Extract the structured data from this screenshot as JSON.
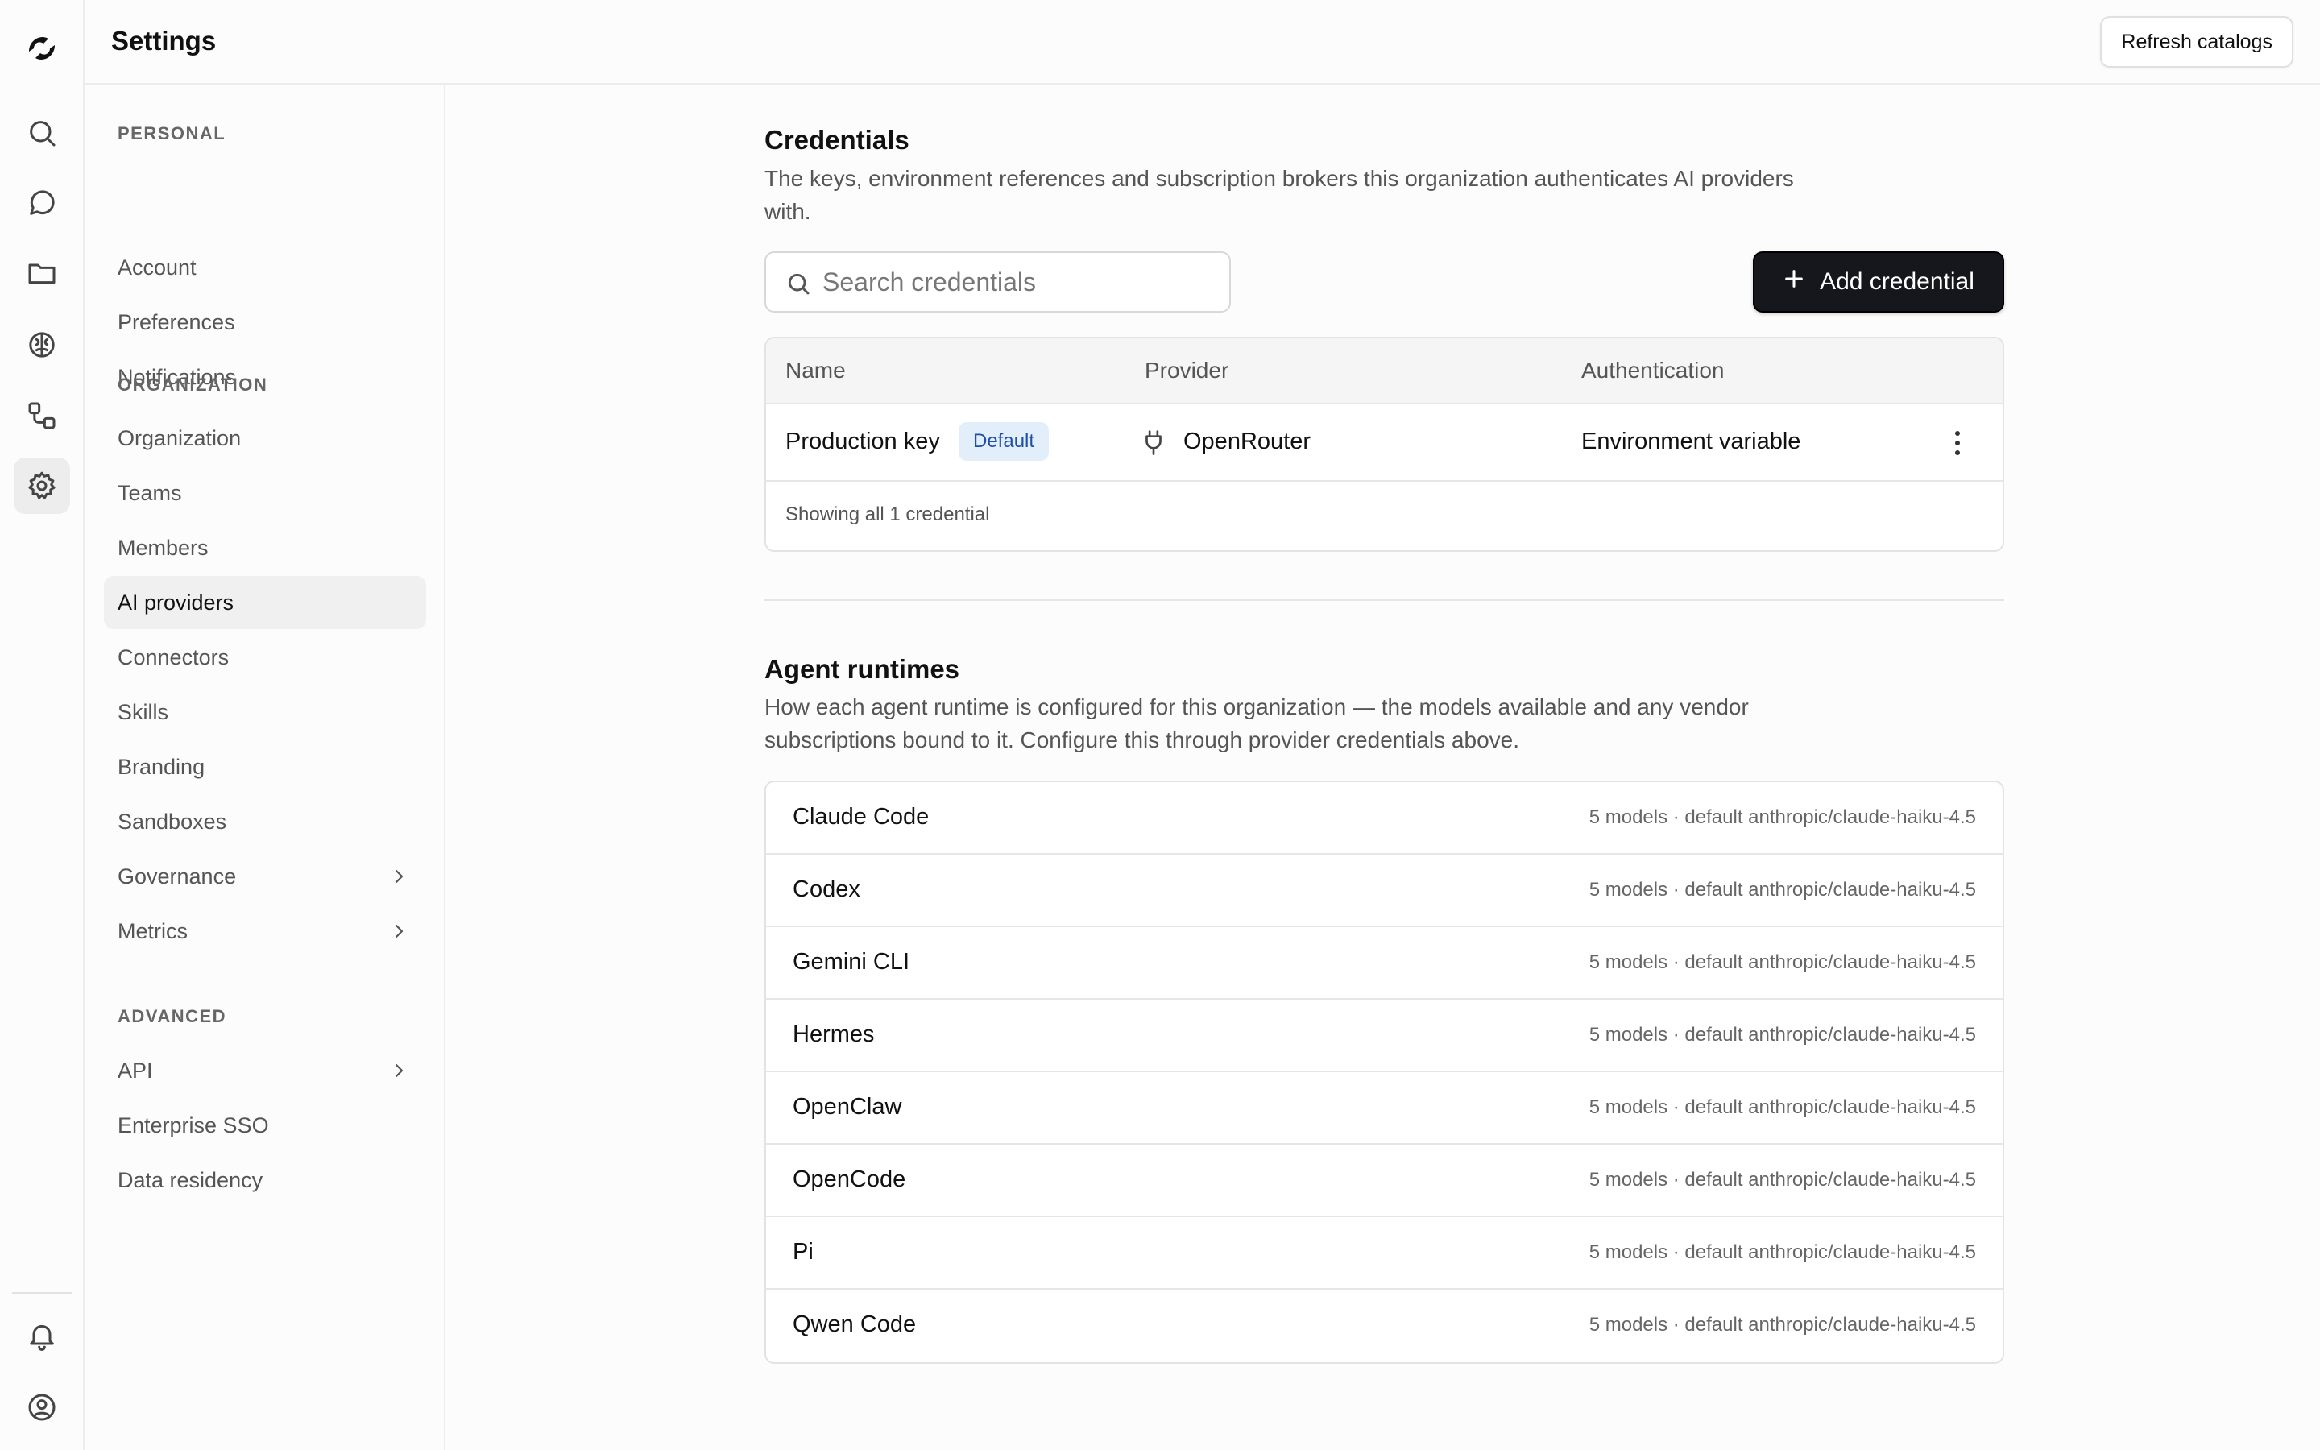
{
  "header": {
    "title": "Settings",
    "refresh_label": "Refresh catalogs"
  },
  "rail": {
    "icons": [
      "logo-icon",
      "search-icon",
      "chat-icon",
      "folder-icon",
      "brain-icon",
      "workflow-icon",
      "gear-icon",
      "bell-icon",
      "user-icon"
    ],
    "active": "gear-icon"
  },
  "sidebar": {
    "personal": {
      "title": "PERSONAL",
      "items": [
        "Account",
        "Preferences",
        "Notifications"
      ]
    },
    "organization": {
      "title": "ORGANIZATION",
      "items": [
        "Organization",
        "Teams",
        "Members",
        "AI providers",
        "Connectors",
        "Skills",
        "Branding",
        "Sandboxes",
        "Governance",
        "Metrics"
      ]
    },
    "advanced": {
      "title": "ADVANCED",
      "items": [
        "API",
        "Enterprise SSO",
        "Data residency"
      ]
    },
    "active": "AI providers"
  },
  "credentials": {
    "title": "Credentials",
    "description": "The keys, environment references and subscription brokers this organization authenticates AI providers with.",
    "search_placeholder": "Search credentials",
    "add_label": "Add credential",
    "columns": [
      "Name",
      "Provider",
      "Authentication"
    ],
    "rows": [
      {
        "name": "Production key",
        "badge": "Default",
        "provider": "OpenRouter",
        "auth": "Environment variable"
      }
    ],
    "footer": "Showing all 1 credential"
  },
  "runtimes": {
    "title": "Agent runtimes",
    "description": "How each agent runtime is configured for this organization — the models available and any vendor subscriptions bound to it. Configure this through provider credentials above.",
    "items": [
      {
        "name": "Claude Code",
        "meta": "5 models · default anthropic/claude-haiku-4.5"
      },
      {
        "name": "Codex",
        "meta": "5 models · default anthropic/claude-haiku-4.5"
      },
      {
        "name": "Gemini CLI",
        "meta": "5 models · default anthropic/claude-haiku-4.5"
      },
      {
        "name": "Hermes",
        "meta": "5 models · default anthropic/claude-haiku-4.5"
      },
      {
        "name": "OpenClaw",
        "meta": "5 models · default anthropic/claude-haiku-4.5"
      },
      {
        "name": "OpenCode",
        "meta": "5 models · default anthropic/claude-haiku-4.5"
      },
      {
        "name": "Pi",
        "meta": "5 models · default anthropic/claude-haiku-4.5"
      },
      {
        "name": "Qwen Code",
        "meta": "5 models · default anthropic/claude-haiku-4.5"
      }
    ]
  },
  "colors": {
    "accent": "#15171d",
    "badge_bg": "#e3eefb",
    "badge_text": "#1f4fa6"
  }
}
